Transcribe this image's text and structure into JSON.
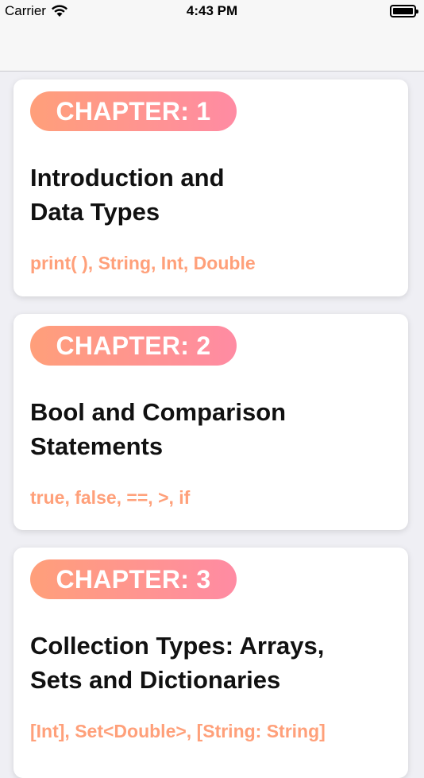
{
  "status_bar": {
    "carrier": "Carrier",
    "time": "4:43 PM"
  },
  "chapters": [
    {
      "badge": "CHAPTER: 1",
      "title": "Introduction and\nData Types",
      "topics": "print( ), String, Int, Double"
    },
    {
      "badge": "CHAPTER: 2",
      "title": "Bool and Comparison\nStatements",
      "topics": "true, false, ==, >, if"
    },
    {
      "badge": "CHAPTER: 3",
      "title": "Collection Types: Arrays,\nSets and Dictionaries",
      "topics": "[Int], Set<Double>, [String: String]"
    }
  ],
  "colors": {
    "badge_gradient_start": "#ff9f7a",
    "badge_gradient_end": "#ff8ba3",
    "topics_text": "#ffa07a"
  }
}
